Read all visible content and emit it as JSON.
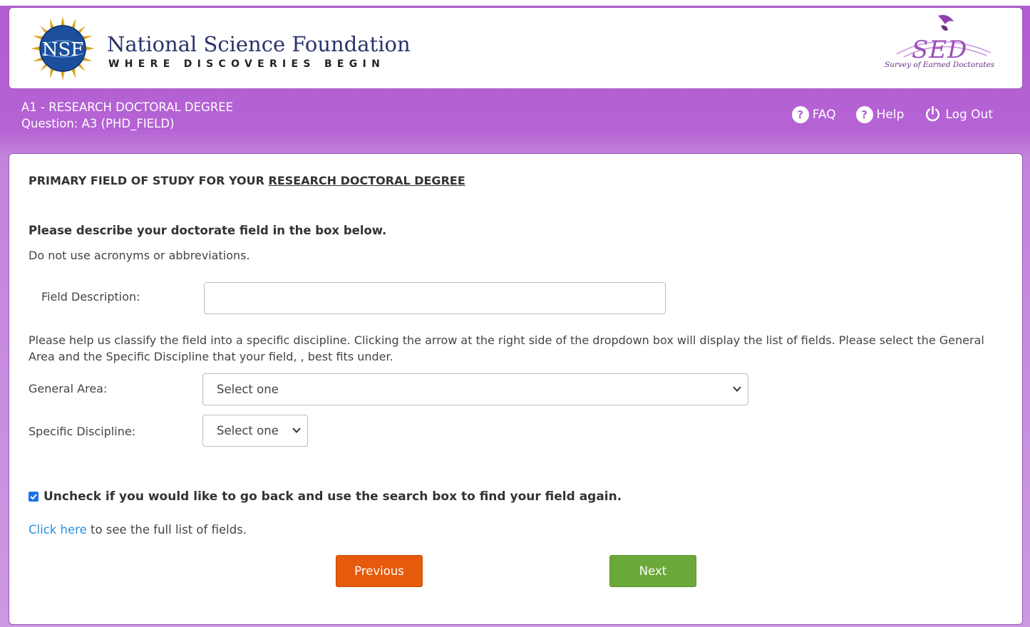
{
  "header": {
    "org_name": "National Science Foundation",
    "tagline": "WHERE DISCOVERIES BEGIN",
    "seal_text": "NSF",
    "sed_logo_text": "SED",
    "sed_logo_subtext": "Survey of Earned Doctorates"
  },
  "subheader": {
    "section": "A1 - RESEARCH DOCTORAL DEGREE",
    "question": "Question: A3 (PHD_FIELD)"
  },
  "nav": {
    "faq": "FAQ",
    "help": "Help",
    "logout": "Log Out"
  },
  "main": {
    "title_prefix": "PRIMARY FIELD OF STUDY FOR YOUR ",
    "title_underlined": "RESEARCH DOCTORAL DEGREE",
    "describe_instruction": "Please describe your doctorate field in the box below.",
    "no_acronyms": "Do not use acronyms or abbreviations.",
    "field_description_label": "Field Description:",
    "field_description_value": "",
    "classify_help": "Please help us classify the field into a specific discipline. Clicking the arrow at the right side of the dropdown box will display the list of fields. Please select the General Area and the Specific Discipline that your field, , best fits under.",
    "general_area_label": "General Area:",
    "general_area_selected": "Select one",
    "specific_discipline_label": "Specific Discipline:",
    "specific_discipline_selected": "Select one",
    "checkbox_checked": true,
    "checkbox_label": "Uncheck if you would like to go back and use the search box to find your field again.",
    "click_here_link": "Click here",
    "click_here_suffix": " to see the full list of fields.",
    "previous_button": "Previous",
    "next_button": "Next"
  },
  "colors": {
    "purple_band": "#b462d4",
    "previous_orange": "#e55a0c",
    "next_green": "#6aa83a",
    "link_blue": "#2a8fdc"
  }
}
